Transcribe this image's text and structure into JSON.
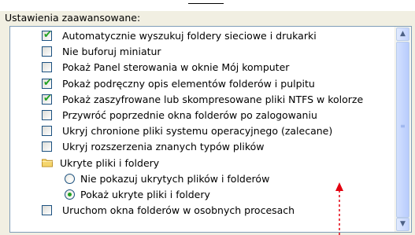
{
  "header": {
    "group_label": "Ustawienia zaawansowane:"
  },
  "items": [
    {
      "type": "checkbox",
      "checked": true,
      "label": "Automatycznie wyszukuj foldery sieciowe i drukarki"
    },
    {
      "type": "checkbox",
      "checked": false,
      "label": "Nie buforuj miniatur"
    },
    {
      "type": "checkbox",
      "checked": false,
      "label": "Pokaż Panel sterowania w oknie Mój komputer"
    },
    {
      "type": "checkbox",
      "checked": true,
      "label": "Pokaż podręczny opis elementów folderów i pulpitu"
    },
    {
      "type": "checkbox",
      "checked": true,
      "label": "Pokaż zaszyfrowane lub skompresowane pliki NTFS w kolorze"
    },
    {
      "type": "checkbox",
      "checked": false,
      "label": "Przywróć poprzednie okna folderów po zalogowaniu"
    },
    {
      "type": "checkbox",
      "checked": false,
      "label": "Ukryj chronione pliki systemu operacyjnego (zalecane)"
    },
    {
      "type": "checkbox",
      "checked": false,
      "label": "Ukryj rozszerzenia znanych typów plików"
    },
    {
      "type": "folder",
      "label": "Ukryte pliki i foldery"
    },
    {
      "type": "radio",
      "checked": false,
      "label": "Nie pokazuj ukrytych plików i folderów"
    },
    {
      "type": "radio",
      "checked": true,
      "label": "Pokaż ukryte pliki i foldery"
    },
    {
      "type": "checkbox",
      "checked": false,
      "label": "Uruchom okna folderów w osobnych procesach"
    }
  ],
  "icons": {
    "checkbox": "checkbox-icon",
    "radio": "radio-icon",
    "folder": "folder-icon",
    "scroll_up": "scroll-up-arrow-icon",
    "scroll_down": "scroll-down-arrow-icon"
  },
  "colors": {
    "check_green": "#21a121",
    "annotation_red": "#e3000f",
    "list_border": "#7f9db9",
    "scrollbar_blue": "#c3d3fd"
  }
}
